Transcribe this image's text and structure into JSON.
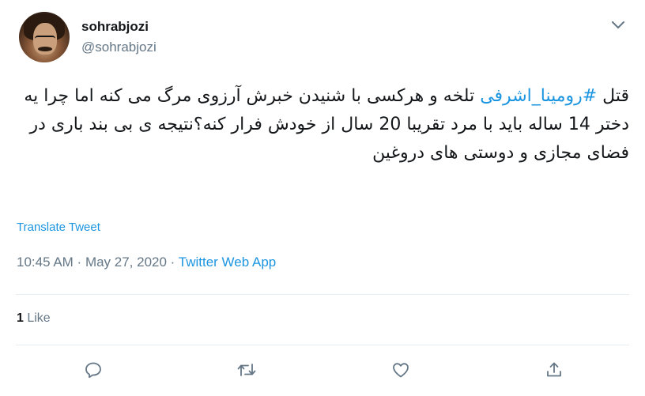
{
  "user": {
    "display_name": "sohrabjozi",
    "handle": "@sohrabjozi"
  },
  "tweet": {
    "text_before_hashtag": "قتل ",
    "hashtag": "#رومینا_اشرفی",
    "text_after_hashtag": " تلخه و هرکسی با شنیدن خبرش آرزوی مرگ می کنه اما چرا یه دختر 14 ساله باید با مرد تقریبا 20 سال از خودش فرار کنه؟نتیجه ی بی بند باری در فضای مجازی و دوستی های دروغین"
  },
  "translate_label": "Translate Tweet",
  "meta": {
    "time": "10:45 AM",
    "separator": " · ",
    "date": "May 27, 2020",
    "source": "Twitter Web App"
  },
  "stats": {
    "likes_count": "1",
    "likes_label": " Like"
  },
  "icons": {
    "more": "chevron-down-icon",
    "reply": "reply-icon",
    "retweet": "retweet-icon",
    "like": "heart-icon",
    "share": "share-icon"
  },
  "colors": {
    "accent": "#1b95e0",
    "secondary_text": "#657786",
    "primary_text": "#14171a",
    "divider": "#e6ecf0"
  }
}
